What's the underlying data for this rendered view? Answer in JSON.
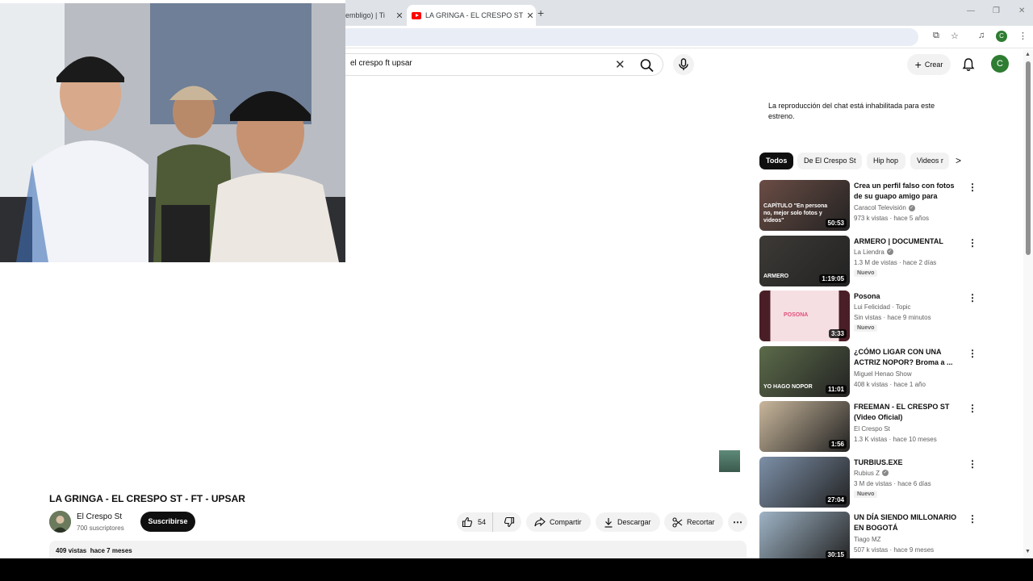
{
  "browser": {
    "tabs": [
      {
        "label": "embligo) | Ti"
      },
      {
        "label": "LA GRINGA - EL CRESPO ST - F"
      }
    ],
    "new_tab": "+",
    "profile_initial": "C"
  },
  "header": {
    "search_value": "el crespo ft upsar",
    "create_label": "Crear",
    "avatar_initial": "C"
  },
  "video": {
    "title": "LA GRINGA - EL CRESPO ST - FT - UPSAR",
    "channel_name": "El Crespo St",
    "channel_subs": "700 suscriptores",
    "subscribe_label": "Suscribirse",
    "likes": "54",
    "share_label": "Compartir",
    "download_label": "Descargar",
    "clip_label": "Recortar",
    "views": "409 vistas",
    "age": "hace 7 meses"
  },
  "sidebar": {
    "chat_note": "La reproducción del chat está inhabilitada para este estreno.",
    "chips": [
      "Todos",
      "De El Crespo St",
      "Hip hop",
      "Videos r"
    ],
    "recommendations": [
      {
        "title": "Crea un perfil falso con fotos de su guapo amigo para enamora...",
        "channel": "Caracol Televisión",
        "verified": true,
        "meta": "973 k vistas · hace 5 años",
        "duration": "50:53",
        "badge": "",
        "thumb_text": "CAPÍTULO \"En persona no, mejor solo fotos y videos\"",
        "thumb_color": "#6b4d45"
      },
      {
        "title": "ARMERO | DOCUMENTAL",
        "channel": "La Liendra",
        "verified": true,
        "meta": "1.3 M de vistas · hace 2 días",
        "duration": "1:19:05",
        "badge": "Nuevo",
        "thumb_text": "ARMERO",
        "thumb_color": "#3d3a36"
      },
      {
        "title": "Posona",
        "channel": "Lui Felicidad · Topic",
        "verified": false,
        "meta": "Sin vistas · hace 9 minutos",
        "duration": "3:33",
        "badge": "Nuevo",
        "thumb_text": "POSONA",
        "thumb_color": "#f6dfe3"
      },
      {
        "title": "¿CÓMO LIGAR CON UNA ACTRIZ NOPOR? Broma a ...",
        "channel": "Miguel Henao Show",
        "verified": false,
        "meta": "408 k vistas · hace 1 año",
        "duration": "11:01",
        "badge": "",
        "thumb_text": "YO HAGO NOPOR",
        "thumb_color": "#5c6b4a"
      },
      {
        "title": "FREEMAN - EL CRESPO ST (Video Oficial)",
        "channel": "El Crespo St",
        "verified": false,
        "meta": "1.3 K vistas · hace 10 meses",
        "duration": "1:56",
        "badge": "",
        "thumb_text": "",
        "thumb_color": "#c9b79c"
      },
      {
        "title": "TURBIUS.EXE",
        "channel": "Rubius Z",
        "verified": true,
        "meta": "3 M de vistas · hace 6 días",
        "duration": "27:04",
        "badge": "Nuevo",
        "thumb_text": "",
        "thumb_color": "#7d90a8"
      },
      {
        "title": "UN DÍA SIENDO MILLONARIO EN BOGOTÁ",
        "channel": "Tiago MZ",
        "verified": false,
        "meta": "507 k vistas · hace 9 meses",
        "duration": "30:15",
        "badge": "",
        "thumb_text": "",
        "thumb_color": "#9fb4c6"
      }
    ]
  }
}
